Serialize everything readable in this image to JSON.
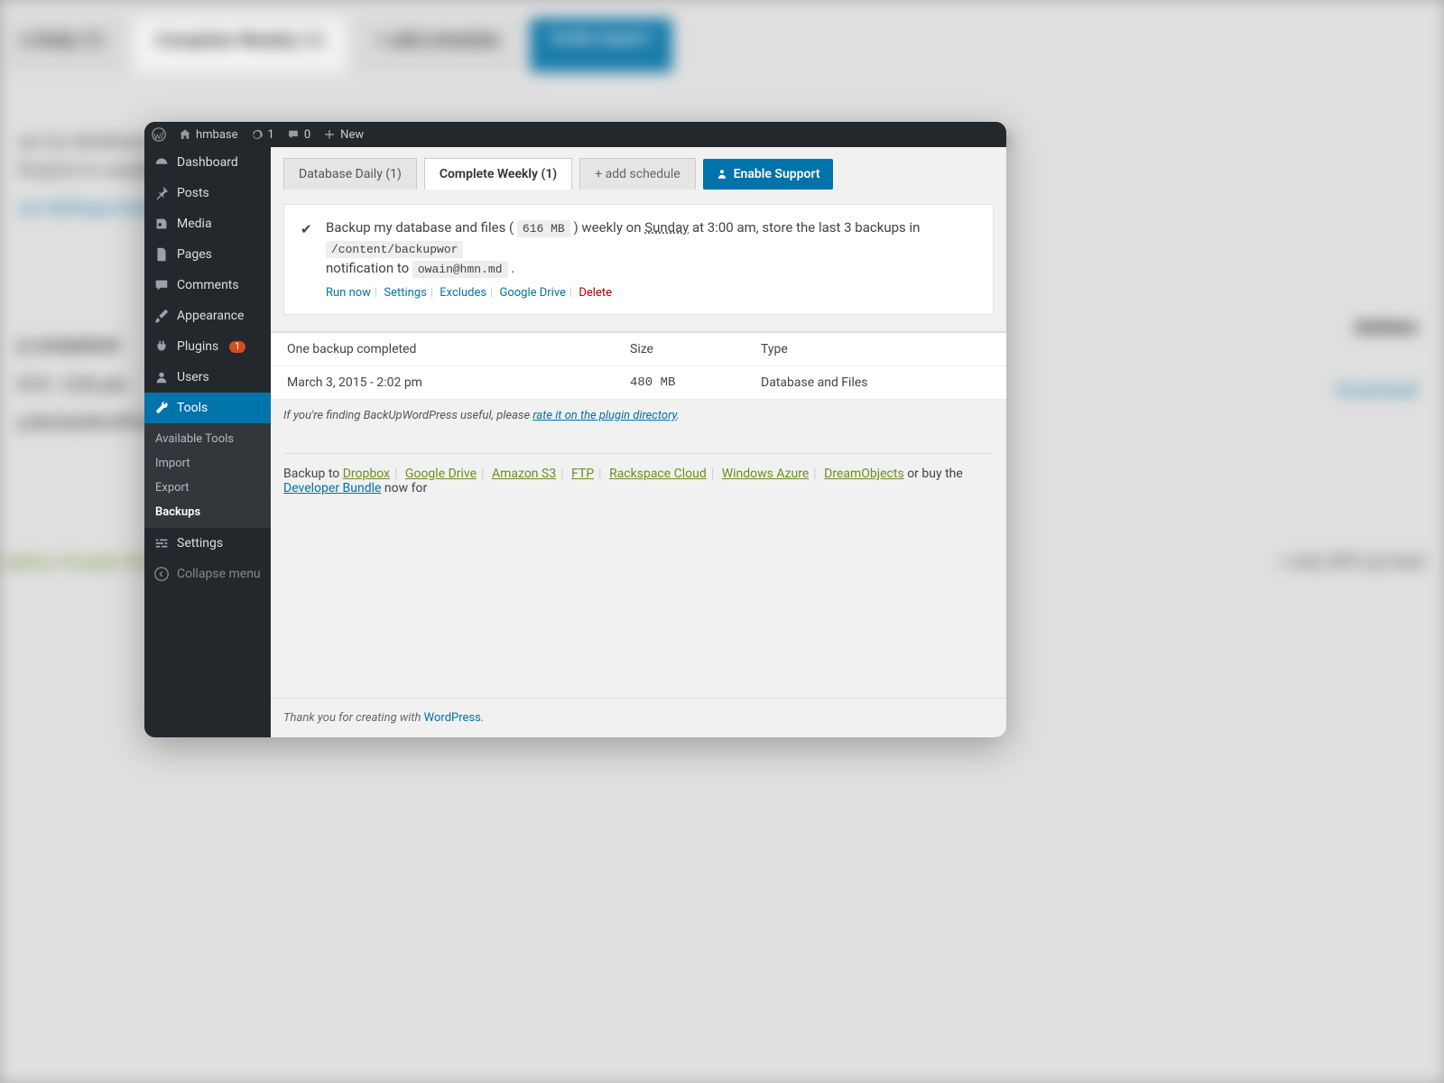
{
  "adminbar": {
    "site_name": "hmbase",
    "updates_count": "1",
    "comments_count": "0",
    "new_label": "New"
  },
  "sidebar": {
    "items": [
      {
        "label": "Dashboard"
      },
      {
        "label": "Posts"
      },
      {
        "label": "Media"
      },
      {
        "label": "Pages"
      },
      {
        "label": "Comments"
      },
      {
        "label": "Appearance"
      },
      {
        "label": "Plugins",
        "badge": "1"
      },
      {
        "label": "Users"
      },
      {
        "label": "Tools"
      },
      {
        "label": "Settings"
      }
    ],
    "submenu": {
      "available_tools": "Available Tools",
      "import": "Import",
      "export": "Export",
      "backups": "Backups"
    },
    "collapse": "Collapse menu"
  },
  "tabs": {
    "db_daily": "Database Daily (1)",
    "complete_weekly": "Complete Weekly (1)",
    "add_schedule": "+ add schedule",
    "enable_support": "Enable Support"
  },
  "summary": {
    "text_prefix": "Backup my database and files (",
    "size": "616 MB",
    "text_mid1": ") weekly on ",
    "day": "Sunday",
    "text_mid2": " at 3:00 am, store the last 3 backups in ",
    "path": "/content/backupwor",
    "text_line2_prefix": "notification to ",
    "email": "owain@hmn.md",
    "text_line2_suffix": " .",
    "actions": {
      "run_now": "Run now",
      "settings": "Settings",
      "excludes": "Excludes",
      "google_drive": "Google Drive",
      "delete": "Delete"
    }
  },
  "table": {
    "header": {
      "status": "One backup completed",
      "size": "Size",
      "type": "Type"
    },
    "row": {
      "date": "March 3, 2015 - 2:02 pm",
      "size": "480 MB",
      "type": "Database and Files"
    }
  },
  "rating": {
    "prefix": "If you're finding BackUpWordPress useful, please ",
    "link": "rate it on the plugin directory",
    "suffix": "."
  },
  "backup_to": {
    "prefix": "Backup to  ",
    "dropbox": "Dropbox",
    "google_drive": "Google Drive",
    "amazon_s3": "Amazon S3",
    "ftp": "FTP",
    "rackspace": "Rackspace Cloud",
    "azure": "Windows Azure",
    "dreamobjects": "DreamObjects",
    "or_buy": "   or buy the ",
    "dev_bundle": "Developer Bundle",
    "now_for": " now for"
  },
  "footer": {
    "prefix": "Thank you for creating with ",
    "link": "WordPress",
    "suffix": "."
  },
  "bg": {
    "tab1": "e Daily (1)",
    "tab2": "Complete Weekly (1)",
    "tab3": "+ add schedule",
    "tab4": "Enable Support",
    "line1": "up my database and files   616 MB   weekly on Sunday at 3:00 am, store the last 3 backups in   /content/backup   ordpress-1d0e8",
    "line2": "fication to   owain@hmn.md",
    "links": "ow   Settings   Excludes",
    "th1": "p completed",
    "th2": "Actions",
    "td1": "015 - 2:02 pm",
    "td2": "Download",
    "note": "g BackUpWordPress",
    "footer_links": "ropbox   Google Drive",
    "footer_right": "r only $99 (a)  Dest"
  }
}
